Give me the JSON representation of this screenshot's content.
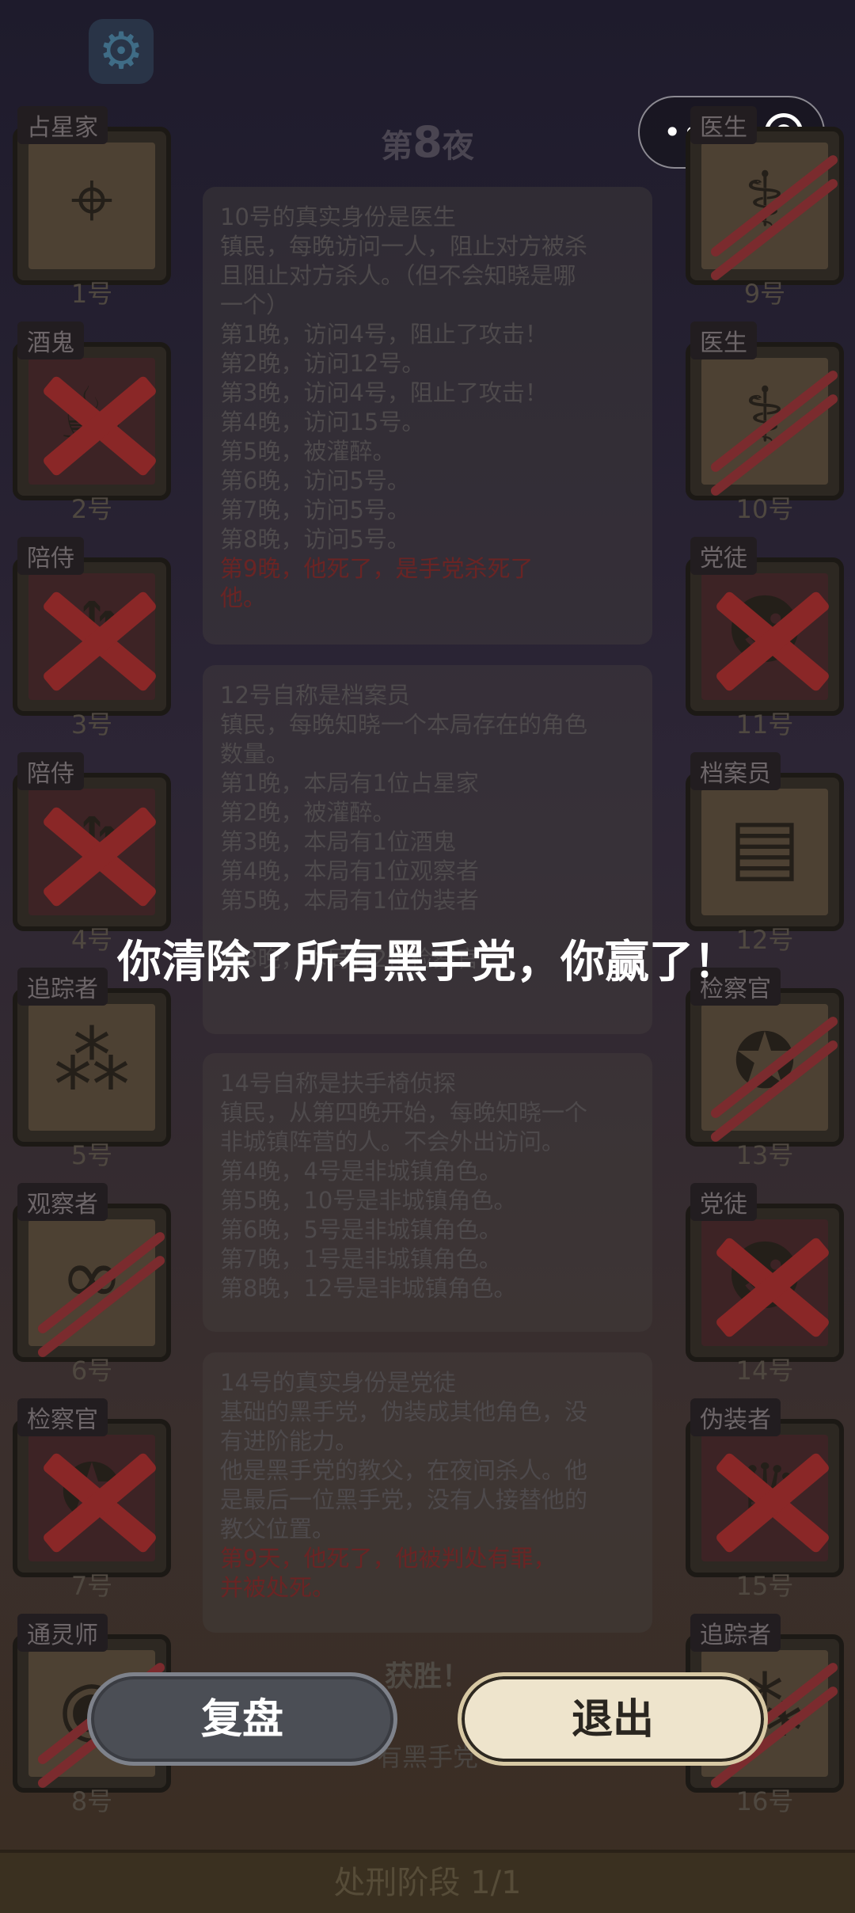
{
  "header": {
    "night_prefix": "第",
    "night_number": "8",
    "night_suffix": "夜",
    "settings_icon": "gear-icon"
  },
  "capsule": {
    "more_icon": "more-dots-icon",
    "close_icon": "record-circle-icon"
  },
  "players_left": [
    {
      "role": "占星家",
      "number": "1号",
      "state": "alive",
      "icon": "sextant-icon"
    },
    {
      "role": "酒鬼",
      "number": "2号",
      "state": "dead",
      "icon": "beer-mug-icon"
    },
    {
      "role": "陪侍",
      "number": "3号",
      "state": "dead",
      "icon": "goblet-icon"
    },
    {
      "role": "陪侍",
      "number": "4号",
      "state": "dead",
      "icon": "goblet-icon"
    },
    {
      "role": "追踪者",
      "number": "5号",
      "state": "alive",
      "icon": "footprints-icon"
    },
    {
      "role": "观察者",
      "number": "6号",
      "state": "attacked",
      "icon": "binoculars-icon"
    },
    {
      "role": "检察官",
      "number": "7号",
      "state": "dead",
      "icon": "badge-icon"
    },
    {
      "role": "通灵师",
      "number": "8号",
      "state": "attacked",
      "icon": "crystal-ball-icon"
    }
  ],
  "players_right": [
    {
      "role": "医生",
      "number": "9号",
      "state": "attacked",
      "icon": "syringe-icon"
    },
    {
      "role": "医生",
      "number": "10号",
      "state": "attacked",
      "icon": "syringe-icon"
    },
    {
      "role": "党徒",
      "number": "11号",
      "state": "dead",
      "icon": "mask-icon"
    },
    {
      "role": "档案员",
      "number": "12号",
      "state": "alive",
      "icon": "documents-icon"
    },
    {
      "role": "检察官",
      "number": "13号",
      "state": "attacked",
      "icon": "badge-icon"
    },
    {
      "role": "党徒",
      "number": "14号",
      "state": "dead",
      "icon": "mask-icon"
    },
    {
      "role": "伪装者",
      "number": "15号",
      "state": "dead",
      "icon": "disguise-icon"
    },
    {
      "role": "追踪者",
      "number": "16号",
      "state": "attacked",
      "icon": "footprints-icon"
    }
  ],
  "logs": [
    {
      "lines": [
        "10号的真实身份是医生",
        "镇民，每晚访问一人，阻止对方被杀",
        "且阻止对方杀人。（但不会知晓是哪",
        "一个）",
        "第1晚，访问4号，阻止了攻击！",
        "第2晚，访问12号。",
        "第3晚，访问4号，阻止了攻击！",
        "第4晚，访问15号。",
        "第5晚，被灌醉。",
        "第6晚，访问5号。",
        "第7晚，访问5号。",
        "第8晚，访问5号。"
      ],
      "red_lines": [
        "第9晚，他死了，是手党杀死了",
        "他。"
      ]
    },
    {
      "lines": [
        "12号自称是档案员",
        "镇民，每晚知晓一个本局存在的角色",
        "数量。",
        "第1晚，本局有1位占星家",
        "第2晚，被灌醉。",
        "第3晚，本局有1位酒鬼",
        "第4晚，本局有1位观察者",
        "第5晚，本局有1位伪装者",
        "",
        "第8晚，本局有2位检察官"
      ],
      "red_lines": []
    },
    {
      "lines": [
        "14号自称是扶手椅侦探",
        "镇民，从第四晚开始，每晚知晓一个",
        "非城镇阵营的人。不会外出访问。",
        "第4晚，4号是非城镇角色。",
        "第5晚，10号是非城镇角色。",
        "第6晚，5号是非城镇角色。",
        "第7晚，1号是非城镇角色。",
        "第8晚，12号是非城镇角色。"
      ],
      "red_lines": []
    },
    {
      "lines": [
        "14号的真实身份是党徒",
        "基础的黑手党，伪装成其他角色，没",
        "有进阶能力。",
        "他是黑手党的教父，在夜间杀人。他",
        "是最后一位黑手党，没有人接替他的",
        "教父位置。"
      ],
      "red_lines": [
        "第9天，他死了，他被判处有罪，",
        "并被处死。"
      ]
    }
  ],
  "victory_text": "获胜！",
  "victory_sub": "有黑手党",
  "phase_label": "处刑阶段 1/1",
  "announcement": "你清除了所有黑手党，你赢了！",
  "buttons": {
    "review": "复盘",
    "exit": "退出"
  }
}
